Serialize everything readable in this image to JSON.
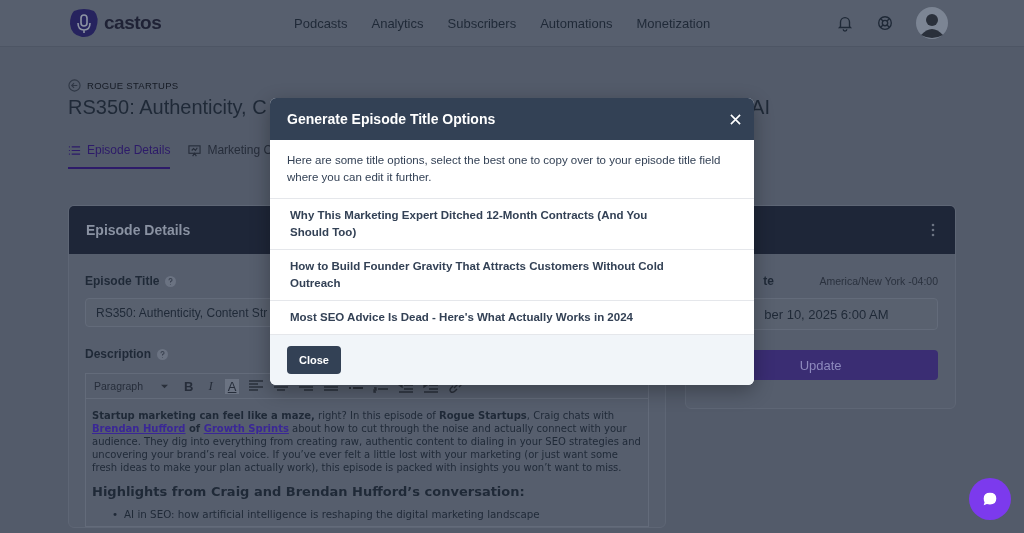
{
  "header": {
    "brand": "castos",
    "nav": [
      {
        "label": "Podcasts",
        "selected": false
      },
      {
        "label": "Analytics",
        "selected": false
      },
      {
        "label": "Subscribers",
        "selected": false
      },
      {
        "label": "Automations",
        "selected": false
      },
      {
        "label": "Monetization",
        "selected": false
      }
    ]
  },
  "breadcrumb": "ROGUE STARTUPS",
  "page_title": {
    "start": "RS350: Authenticity, C",
    "end": "AI"
  },
  "tabs": [
    {
      "label": "Episode Details",
      "selected": true
    },
    {
      "label": "Marketing C",
      "selected": false
    }
  ],
  "details_card": {
    "title": "Episode Details",
    "episode_title_label": "Episode Title",
    "episode_title_value": "RS350: Authenticity, Content Str",
    "description_label": "Description",
    "toolbar": [
      {
        "kind": "select",
        "label": "Paragraph"
      },
      {
        "kind": "bold",
        "label": "B"
      },
      {
        "kind": "italic",
        "label": "I"
      },
      {
        "kind": "color",
        "label": "A"
      },
      {
        "kind": "align-left"
      },
      {
        "kind": "align-center"
      },
      {
        "kind": "align-right"
      },
      {
        "kind": "align-justify"
      },
      {
        "kind": "bullet-list"
      },
      {
        "kind": "numbered-list"
      },
      {
        "kind": "outdent"
      },
      {
        "kind": "indent"
      },
      {
        "kind": "link"
      }
    ],
    "paragraph": [
      {
        "kind": "bold",
        "text": "Startup marketing can feel like a maze,"
      },
      {
        "kind": "text",
        "text": " right? In this episode of "
      },
      {
        "kind": "bold",
        "text": "Rogue Startups"
      },
      {
        "kind": "text",
        "text": ", Craig chats with "
      },
      {
        "kind": "link",
        "text": "Brendan Hufford"
      },
      {
        "kind": "bold",
        "text": " of "
      },
      {
        "kind": "link",
        "text": "Growth Sprints"
      },
      {
        "kind": "text",
        "text": " about how to cut through the noise and actually connect with your audience. They dig into everything from creating raw, authentic content to dialing in your SEO strategies and uncovering your brand’s real voice. If you’ve ever felt a little lost with your marketing (or just want some fresh ideas to make your plan actually work), this episode is packed with insights you won’t want to miss."
      }
    ],
    "heading": "Highlights from Craig and Brendan Hufford’s conversation:",
    "bullets": [
      {
        "marker": "•",
        "text": "AI in SEO: how artificial intelligence is reshaping the digital marketing landscape"
      }
    ]
  },
  "publish_card": {
    "label_fragment": "te",
    "timezone": "America/New York -04:00",
    "date_value": "ber 10, 2025 6:00 AM",
    "button": "Update"
  },
  "modal": {
    "title": "Generate Episode Title Options",
    "intro": "Here are some title options, select the best one to copy over to your episode title field where you can edit it further.",
    "options": [
      "Why This Marketing Expert Ditched 12-Month Contracts (And You Should Too)",
      "How to Build Founder Gravity That Attracts Customers Without Cold Outreach",
      "Most SEO Advice Is Dead - Here's What Actually Works in 2024"
    ],
    "close_button": "Close"
  }
}
